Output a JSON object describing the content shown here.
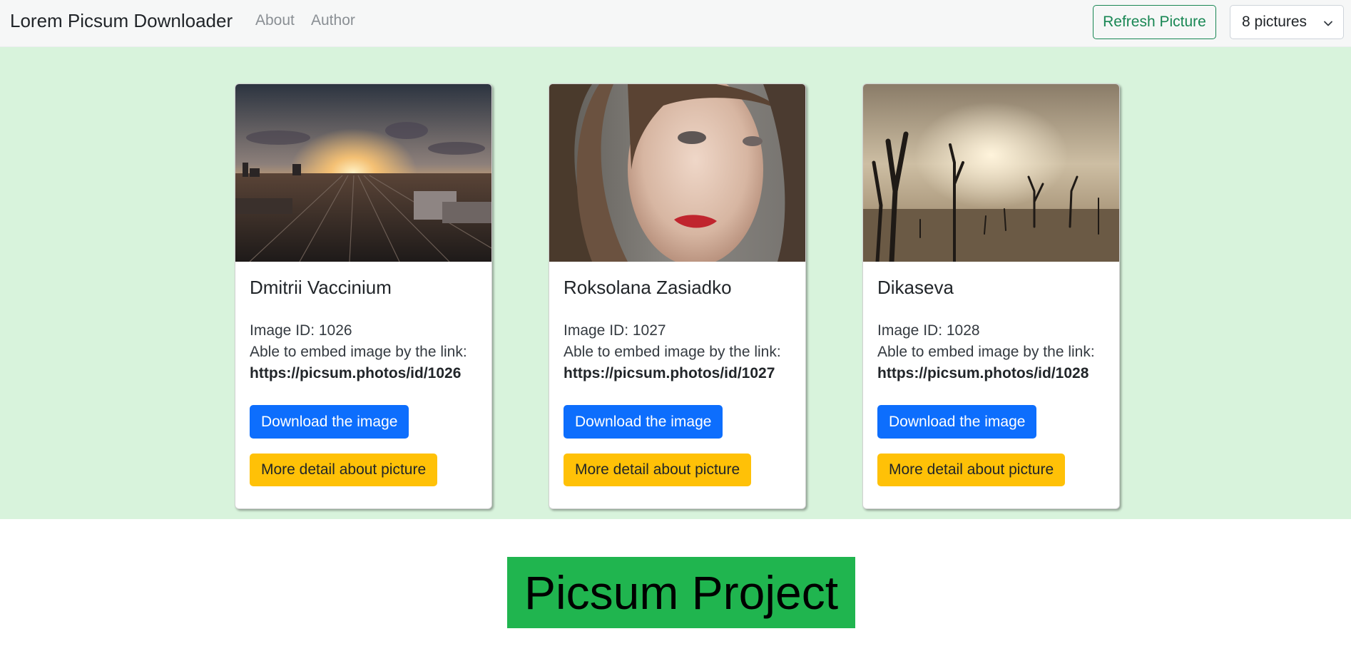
{
  "navbar": {
    "brand": "Lorem Picsum Downloader",
    "links": [
      "About",
      "Author"
    ],
    "refresh_label": "Refresh Picture",
    "count_select": {
      "selected": "8 pictures",
      "icon": "chevron-down-icon"
    },
    "accent": "#198754"
  },
  "gallery": {
    "background": "#d8f3dc",
    "cards": [
      {
        "author": "Dmitrii Vaccinium",
        "image_id_label": "Image ID: 1026",
        "embed_label": "Able to embed image by the link:",
        "link": "https://picsum.photos/id/1026",
        "download_label": "Download the image",
        "detail_label": "More detail about picture",
        "image_subject": "railway yard at sunset"
      },
      {
        "author": "Roksolana Zasiadko",
        "image_id_label": "Image ID: 1027",
        "embed_label": "Able to embed image by the link:",
        "link": "https://picsum.photos/id/1027",
        "download_label": "Download the image",
        "detail_label": "More detail about picture",
        "image_subject": "portrait of woman"
      },
      {
        "author": "Dikaseva",
        "image_id_label": "Image ID: 1028",
        "embed_label": "Able to embed image by the link:",
        "link": "https://picsum.photos/id/1028",
        "download_label": "Download the image",
        "detail_label": "More detail about picture",
        "image_subject": "dead trees in foggy landscape"
      }
    ],
    "colors": {
      "primary": "#0d6efd",
      "warning": "#ffc107"
    }
  },
  "footer": {
    "banner_text": "Picsum Project",
    "banner_color": "#20b54f"
  }
}
